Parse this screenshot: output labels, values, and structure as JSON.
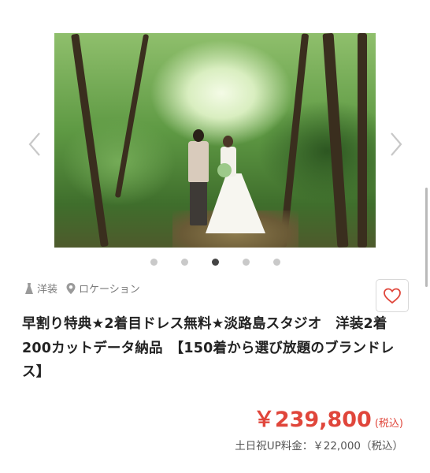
{
  "carousel": {
    "slide_count": 5,
    "active_index": 2,
    "prev_icon": "chevron-left-icon",
    "next_icon": "chevron-right-icon"
  },
  "tags": [
    {
      "icon": "dress-icon",
      "label": "洋装"
    },
    {
      "icon": "location-pin-icon",
      "label": "ロケーション"
    }
  ],
  "favorite": {
    "icon": "heart-outline-icon",
    "color": "#e0463b"
  },
  "plan": {
    "title": "早割り特典★2着目ドレス無料★淡路島スタジオ　洋装2着　200カットデータ納品　【150着から選び放題のブランドレス】",
    "price": "￥239,800",
    "price_tax": "(税込)",
    "holiday_fee": "土日祝UP料金：￥22,000（税込）"
  },
  "colors": {
    "accent": "#e0463b",
    "text": "#222222",
    "muted": "#7a7a7a"
  }
}
